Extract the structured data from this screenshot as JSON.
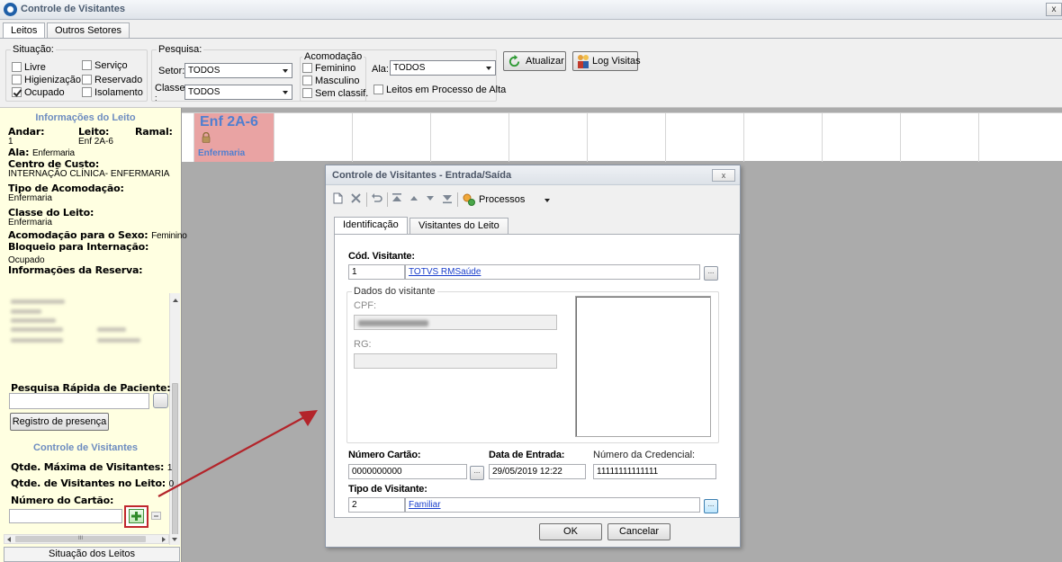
{
  "window": {
    "title": "Controle de Visitantes",
    "close_glyph": "x"
  },
  "tabs": [
    {
      "label": "Leitos"
    },
    {
      "label": "Outros Setores"
    }
  ],
  "filters": {
    "situacao": {
      "title": "Situação:",
      "items": [
        {
          "label": "Livre",
          "checked": false
        },
        {
          "label": "Serviço",
          "checked": false
        },
        {
          "label": "Higienização",
          "checked": false
        },
        {
          "label": "Reservado",
          "checked": false
        },
        {
          "label": "Ocupado",
          "checked": true
        },
        {
          "label": "Isolamento",
          "checked": false
        }
      ]
    },
    "pesquisa": {
      "title": "Pesquisa:",
      "setor_label": "Setor:",
      "setor_value": "TODOS",
      "classe_label": "Classe",
      "classe_suffix": ":",
      "classe_value": "TODOS"
    },
    "acomodacao": {
      "title": "Acomodação",
      "items": [
        {
          "label": "Feminino",
          "checked": false
        },
        {
          "label": "Masculino",
          "checked": false
        },
        {
          "label": "Sem classif.",
          "checked": false
        }
      ]
    },
    "ala_label": "Ala:",
    "ala_value": "TODOS",
    "alta_label": "Leitos em Processo de Alta",
    "refresh_label": "Atualizar",
    "log_label": "Log Visitas"
  },
  "info": {
    "header": "Informações do Leito",
    "andar_label": "Andar:",
    "andar_value": "1",
    "leito_label": "Leito:",
    "leito_value": "Enf 2A-6",
    "ramal_label": "Ramal:",
    "ala_label": "Ala:",
    "ala_value": "Enfermaria",
    "centro_label": "Centro de Custo:",
    "centro_value": "INTERNAÇÃO CLÍNICA- ENFERMARIA",
    "tipo_label": "Tipo de Acomodação:",
    "tipo_value": "Enfermaria",
    "classe_label": "Classe do Leito:",
    "classe_value": "Enfermaria",
    "sexo_label": "Acomodação para o Sexo:",
    "sexo_value": "Feminino",
    "bloqueio_label": "Bloqueio para Internação:",
    "bloqueio_value": "Ocupado",
    "reserva_label": "Informações da Reserva:",
    "pesquisa_label": "Pesquisa Rápida de Paciente:",
    "registro_label": "Registro de presença",
    "visitantes_header": "Controle de Visitantes",
    "max_label": "Qtde. Máxima de Visitantes:",
    "max_value": "1",
    "qtd_label": "Qtde. de Visitantes no Leito:",
    "qtd_value": "0",
    "cartao_label": "Número do Cartão:",
    "scroll_mid": "III",
    "status_tab": "Situação dos Leitos"
  },
  "bed": {
    "name": "Enf 2A-6",
    "type": "Enfermaria",
    "color": "#e9a3a3"
  },
  "dialog": {
    "title": "Controle de Visitantes - Entrada/Saída",
    "close_glyph": "x",
    "processos_label": "Processos",
    "tabs": [
      {
        "label": "Identificação"
      },
      {
        "label": "Visitantes do Leito"
      }
    ],
    "cod_label": "Cód. Visitante:",
    "cod_value": "1",
    "cod_name": "TOTVS RMSaúde",
    "dados_title": "Dados do visitante",
    "cpf_label": "CPF:",
    "rg_label": "RG:",
    "cartao_label": "Número Cartão:",
    "cartao_value": "0000000000",
    "data_label": "Data de Entrada:",
    "data_value": "29/05/2019 12:22",
    "credencial_label": "Número da Credencial:",
    "credencial_value": "11111111111111",
    "tipo_label": "Tipo de Visitante:",
    "tipo_value": "2",
    "tipo_name": "Familiar",
    "ellipsis": "...",
    "ok_label": "OK",
    "cancel_label": "Cancelar"
  }
}
